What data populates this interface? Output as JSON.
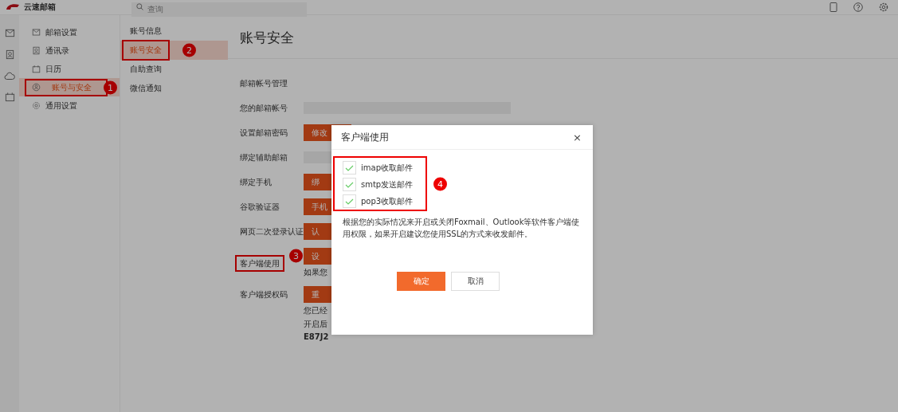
{
  "app": {
    "title": "云速邮箱"
  },
  "search": {
    "placeholder": "查询"
  },
  "sidebar": {
    "items": [
      {
        "label": "邮箱设置",
        "selected": false
      },
      {
        "label": "通讯录",
        "selected": false
      },
      {
        "label": "日历",
        "selected": false
      },
      {
        "label": "账号与安全",
        "selected": true,
        "marker": "1"
      },
      {
        "label": "通用设置",
        "selected": false
      }
    ]
  },
  "subnav": {
    "items": [
      {
        "label": "账号信息",
        "selected": false
      },
      {
        "label": "账号安全",
        "selected": true,
        "marker": "2"
      },
      {
        "label": "自助查询",
        "selected": false
      },
      {
        "label": "微信通知",
        "selected": false
      }
    ]
  },
  "content": {
    "title": "账号安全",
    "rows": [
      {
        "kind": "heading",
        "label": "邮箱帐号管理"
      },
      {
        "kind": "field",
        "label": "您的邮箱帐号"
      },
      {
        "kind": "button",
        "label": "设置邮箱密码",
        "button": "修改"
      },
      {
        "kind": "field",
        "label": "绑定辅助邮箱"
      },
      {
        "kind": "button",
        "label": "绑定手机",
        "button": "绑"
      },
      {
        "kind": "button",
        "label": "谷歌验证器",
        "button": "手机"
      },
      {
        "kind": "button",
        "label": "网页二次登录认证",
        "button": "认"
      },
      {
        "kind": "button",
        "label": "客户端使用",
        "button": "设",
        "marker": "3",
        "notes": [
          "如果您"
        ]
      },
      {
        "kind": "button",
        "label": "客户端授权码",
        "button": "重",
        "notes": [
          "您已经",
          "开启后"
        ],
        "code": "E87J2"
      }
    ]
  },
  "dialog": {
    "title": "客户端使用",
    "close": "×",
    "marker": "4",
    "options": [
      {
        "label": "imap收取邮件",
        "checked": true
      },
      {
        "label": "smtp发送邮件",
        "checked": true
      },
      {
        "label": "pop3收取邮件",
        "checked": true
      }
    ],
    "description": "根据您的实际情况来开启或关闭Foxmail、Outlook等软件客户端使用权限，如果开启建议您使用SSL的方式来收发邮件。",
    "buttons": [
      {
        "label": "确定",
        "kind": "primary"
      },
      {
        "label": "取消",
        "kind": "secondary"
      }
    ]
  }
}
